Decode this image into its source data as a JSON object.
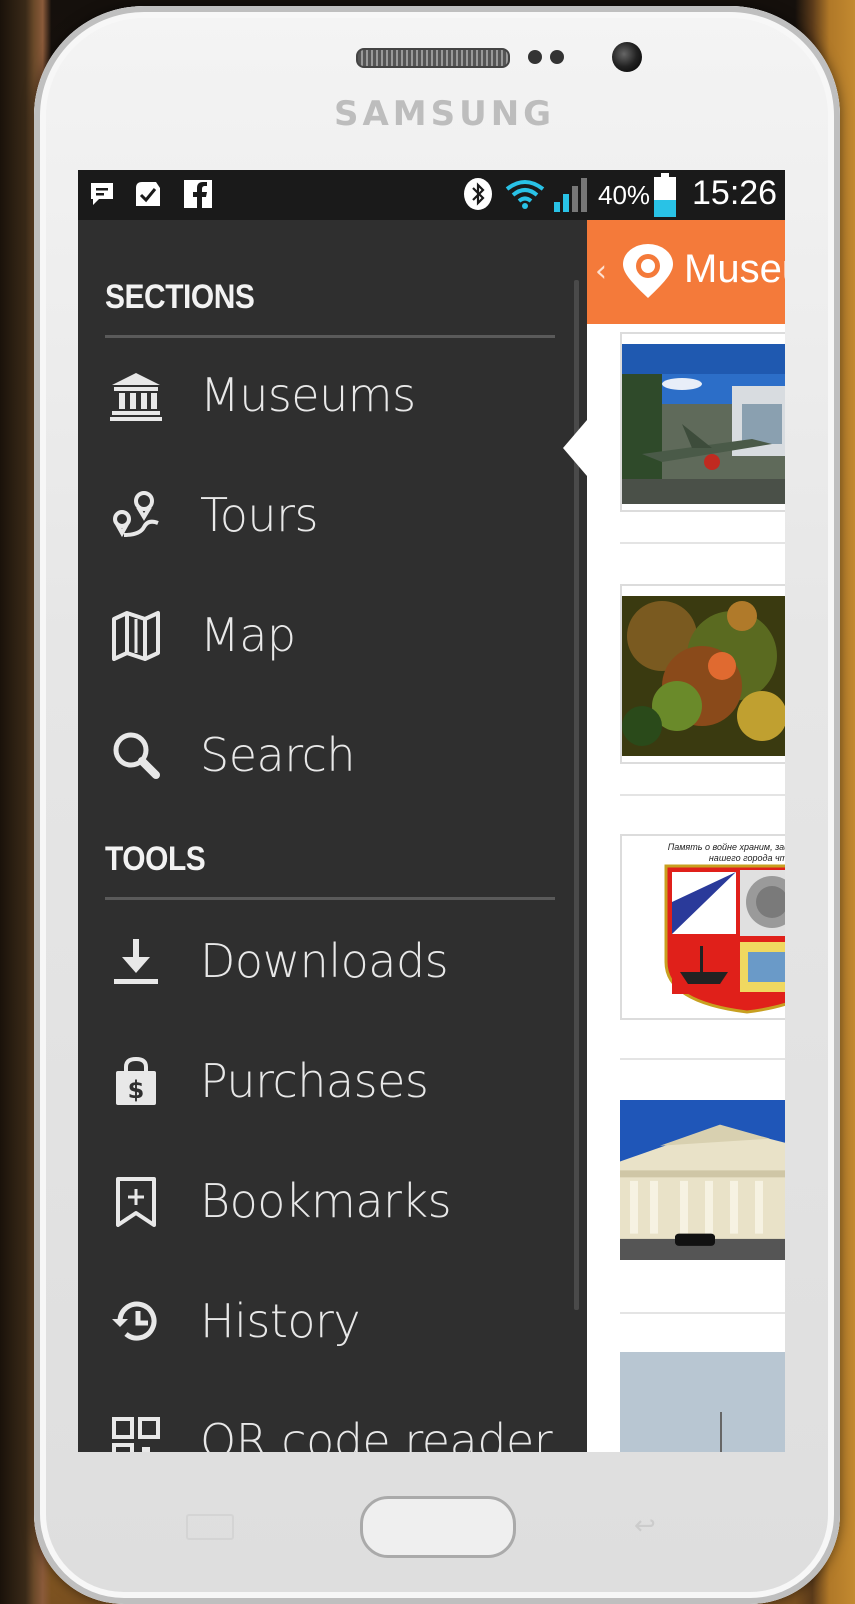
{
  "device": {
    "brand": "SAMSUNG"
  },
  "status_bar": {
    "battery_percent": "40%",
    "time": "15:26",
    "battery_level": 0.4,
    "notifications": [
      "chat-icon",
      "check-icon",
      "facebook-icon"
    ],
    "system_icons": [
      "bluetooth-icon",
      "wifi-icon",
      "signal-icon"
    ]
  },
  "drawer": {
    "sections_header": "SECTIONS",
    "sections": [
      {
        "label": "Museums",
        "icon": "museum-icon",
        "selected": true
      },
      {
        "label": "Tours",
        "icon": "tour-route-icon"
      },
      {
        "label": "Map",
        "icon": "map-icon"
      },
      {
        "label": "Search",
        "icon": "search-icon"
      }
    ],
    "tools_header": "TOOLS",
    "tools": [
      {
        "label": "Downloads",
        "icon": "download-icon"
      },
      {
        "label": "Purchases",
        "icon": "purchase-bag-icon"
      },
      {
        "label": "Bookmarks",
        "icon": "bookmark-icon"
      },
      {
        "label": "History",
        "icon": "history-icon"
      },
      {
        "label": "QR code reader",
        "icon": "qr-code-icon"
      }
    ]
  },
  "content": {
    "title": "Museu",
    "accent_color": "#f47a3a",
    "cards": [
      {
        "image": "aircraft-museum-photo",
        "caption": ""
      },
      {
        "image": "colorful-art-photo",
        "caption": ""
      },
      {
        "image": "coat-of-arms-poster",
        "caption": "Память о войне храним, защитников нашего города чт"
      },
      {
        "image": "classical-building-photo",
        "caption": ""
      },
      {
        "image": "sky-photo",
        "caption": ""
      }
    ]
  }
}
